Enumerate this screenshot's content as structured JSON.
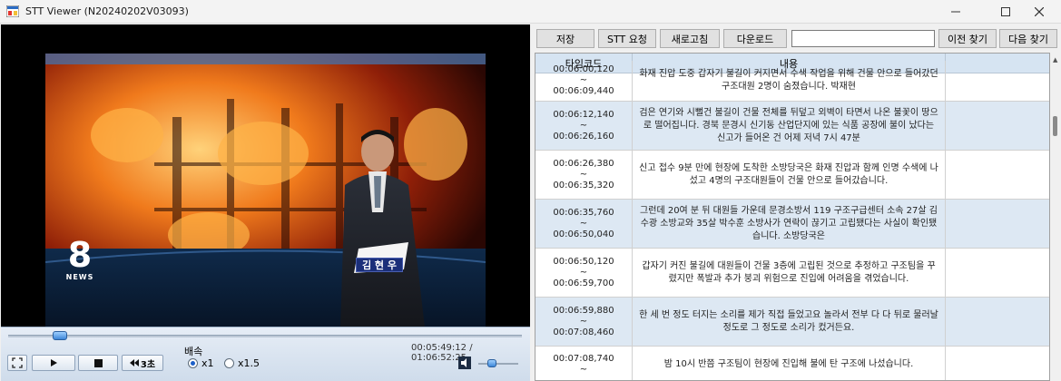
{
  "window": {
    "title": "STT Viewer (N20240202V03093)"
  },
  "video": {
    "logo_number": "8",
    "logo_text": "NEWS",
    "caption": "김 현 우"
  },
  "player": {
    "seek_fraction": 0.1,
    "rewind_label": "3초",
    "speed_label": "배속",
    "speed_options": [
      "x1",
      "x1.5"
    ],
    "speed_selected": "x1",
    "current_time": "00:05:49:12",
    "separator": "/",
    "total_time": "01:06:52:25",
    "volume_fraction": 0.35
  },
  "toolbar": {
    "save": "저장",
    "stt_request": "STT 요청",
    "refresh": "새로고침",
    "download": "다운로드",
    "search_value": "",
    "prev_find": "이전 찾기",
    "next_find": "다음 찾기"
  },
  "grid": {
    "columns": [
      "타임코드",
      "내용"
    ],
    "rows": [
      {
        "start": "00:06:00,120",
        "sep": "~",
        "end": "00:06:09,440",
        "text": "화재 진압 도중 갑자기 불길이 커지면서 수색 작업을 위해 건물 안으로 들어갔던 구조대원 2명이 숨졌습니다. 박재현"
      },
      {
        "start": "00:06:12,140",
        "sep": "~",
        "end": "00:06:26,160",
        "text": "검은 연기와 시뻘건 불길이 건물 전체를 뒤덮고 외벽이 타면서 나온 불꽃이 땅으로 떨어집니다. 경북 문경시 신기동 산업단지에 있는 식품 공장에 불이 났다는 신고가 들어온 건 어제 저녁 7시 47분"
      },
      {
        "start": "00:06:26,380",
        "sep": "~",
        "end": "00:06:35,320",
        "text": "신고 접수 9분 만에 현장에 도착한 소방당국은 화재 진압과 함께 인명 수색에 나섰고 4명의 구조대원들이 건물 안으로 들어갔습니다."
      },
      {
        "start": "00:06:35,760",
        "sep": "~",
        "end": "00:06:50,040",
        "text": "그런데 20여 분 뒤 대원들 가운데 문경소방서 119 구조구급센터 소속 27살 김수광 소방교와 35살 박수훈 소방사가 연락이 끊기고 고립됐다는 사실이 확인됐습니다. 소방당국은"
      },
      {
        "start": "00:06:50,120",
        "sep": "~",
        "end": "00:06:59,700",
        "text": "갑자기 커진 불길에 대원들이 건물 3층에 고립된 것으로 추정하고 구조팀을 꾸렸지만 폭발과 추가 붕괴 위험으로 진입에 어려움을 겪었습니다."
      },
      {
        "start": "00:06:59,880",
        "sep": "~",
        "end": "00:07:08,460",
        "text": "한 세 번 정도 터지는 소리를 제가 직접 들었고요 놀라서 전부 다 다 뒤로 물러날 정도로 그 정도로 소리가 컸거든요."
      },
      {
        "start": "00:07:08,740",
        "sep": "~",
        "end": "",
        "text": "밤 10시 반쯤 구조팀이 현장에 진입해 불에 탄 구조에 나섰습니다."
      }
    ]
  }
}
